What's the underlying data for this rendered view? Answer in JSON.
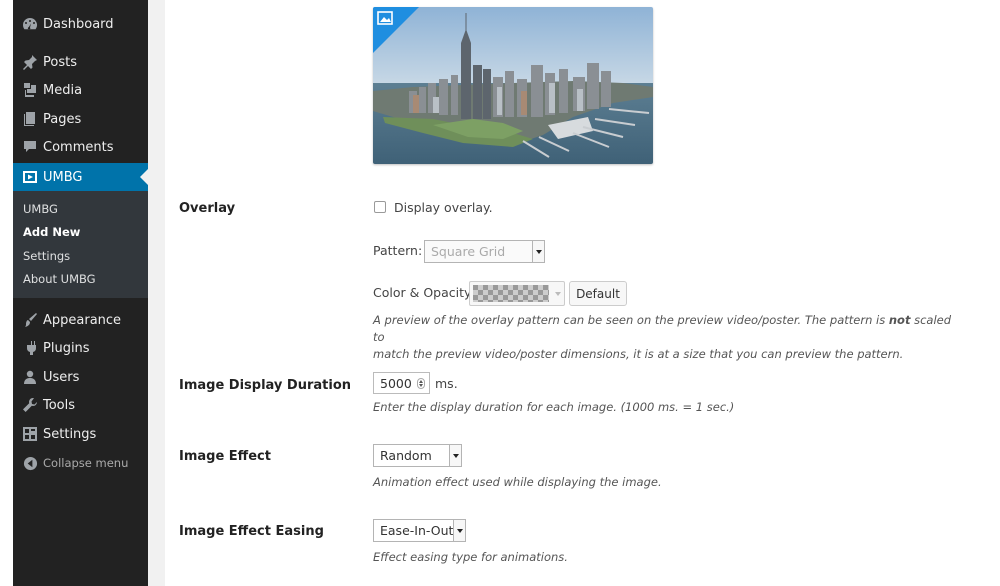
{
  "menu": {
    "items": [
      {
        "label": "Dashboard",
        "icon": "dashboard-icon"
      },
      {
        "label": "Posts",
        "icon": "pin-icon"
      },
      {
        "label": "Media",
        "icon": "media-icon"
      },
      {
        "label": "Pages",
        "icon": "pages-icon"
      },
      {
        "label": "Comments",
        "icon": "comment-icon"
      },
      {
        "label": "UMBG",
        "icon": "video-icon",
        "current": true
      },
      {
        "label": "Appearance",
        "icon": "brush-icon"
      },
      {
        "label": "Plugins",
        "icon": "plug-icon"
      },
      {
        "label": "Users",
        "icon": "user-icon"
      },
      {
        "label": "Tools",
        "icon": "wrench-icon"
      },
      {
        "label": "Settings",
        "icon": "settings-icon"
      }
    ],
    "submenu": [
      "UMBG",
      "Add New",
      "Settings",
      "About UMBG"
    ],
    "submenu_active": "Add New",
    "collapse_label": "Collapse menu",
    "accent_color": "#0073aa"
  },
  "form": {
    "overlay": {
      "label": "Overlay",
      "checkbox_label": "Display overlay.",
      "checked": false,
      "pattern_label": "Pattern:",
      "pattern_value": "Square Grid",
      "color_label": "Color & Opacity:",
      "default_button": "Default",
      "desc_line1_a": "A preview of the overlay pattern can be seen on the preview video/poster. The pattern is ",
      "desc_line1_b": "not",
      "desc_line1_c": " scaled to",
      "desc_line2": "match the preview video/poster dimensions, it is at a size that you can preview the pattern."
    },
    "duration": {
      "label": "Image Display Duration",
      "value": "5000",
      "unit": "ms.",
      "desc": "Enter the display duration for each image. (1000 ms. = 1 sec.)"
    },
    "effect": {
      "label": "Image Effect",
      "value": "Random",
      "desc": "Animation effect used while displaying the image."
    },
    "easing": {
      "label": "Image Effect Easing",
      "value": "Ease-In-Out",
      "desc": "Effect easing type for animations."
    }
  }
}
